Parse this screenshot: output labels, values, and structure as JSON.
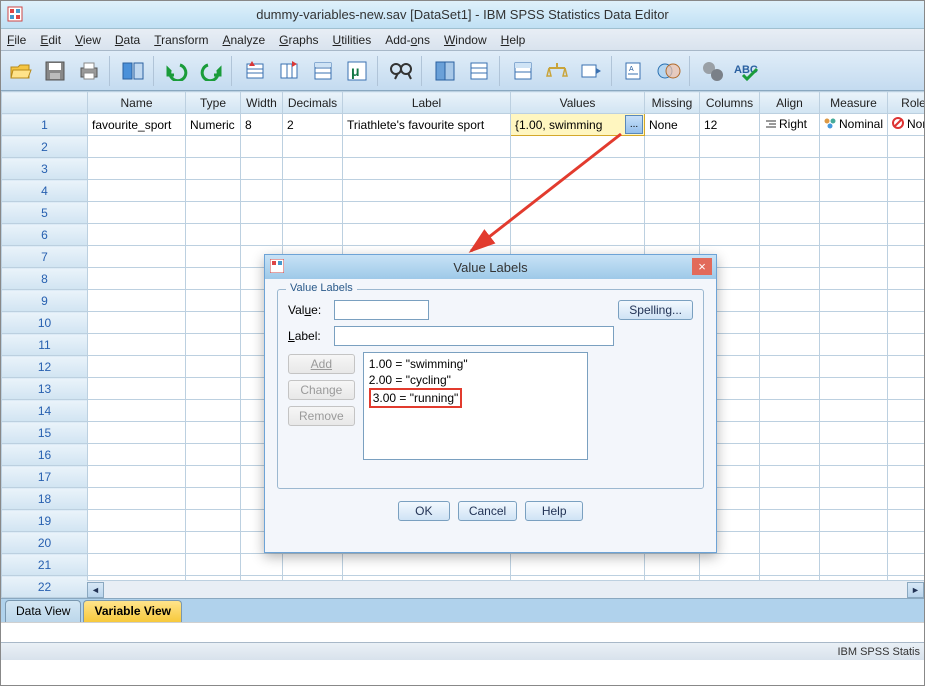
{
  "window": {
    "title": "dummy-variables-new.sav [DataSet1] - IBM SPSS Statistics Data Editor"
  },
  "menu": [
    "File",
    "Edit",
    "View",
    "Data",
    "Transform",
    "Analyze",
    "Graphs",
    "Utilities",
    "Add-ons",
    "Window",
    "Help"
  ],
  "columns": [
    "",
    "Name",
    "Type",
    "Width",
    "Decimals",
    "Label",
    "Values",
    "Missing",
    "Columns",
    "Align",
    "Measure",
    "Role"
  ],
  "row": {
    "num": "1",
    "name": "favourite_sport",
    "type": "Numeric",
    "width": "8",
    "decimals": "2",
    "label": "Triathlete's favourite sport",
    "values": "{1.00, swimming",
    "missing": "None",
    "cols": "12",
    "align": "Right",
    "measure": "Nominal",
    "role": "None"
  },
  "empty_rows": [
    "2",
    "3",
    "4",
    "5",
    "6",
    "7",
    "8",
    "9",
    "10",
    "11",
    "12",
    "13",
    "14",
    "15",
    "16",
    "17",
    "18",
    "19",
    "20",
    "21",
    "22"
  ],
  "tabs": {
    "data_view": "Data View",
    "variable_view": "Variable View"
  },
  "status": "IBM SPSS Statis",
  "dialog": {
    "title": "Value Labels",
    "group": "Value Labels",
    "value_lbl": "Value:",
    "label_lbl": "Label:",
    "spelling": "Spelling...",
    "add": "Add",
    "change": "Change",
    "remove": "Remove",
    "entries": [
      "1.00 = \"swimming\"",
      "2.00 = \"cycling\"",
      "3.00 = \"running\""
    ],
    "ok": "OK",
    "cancel": "Cancel",
    "help": "Help"
  }
}
